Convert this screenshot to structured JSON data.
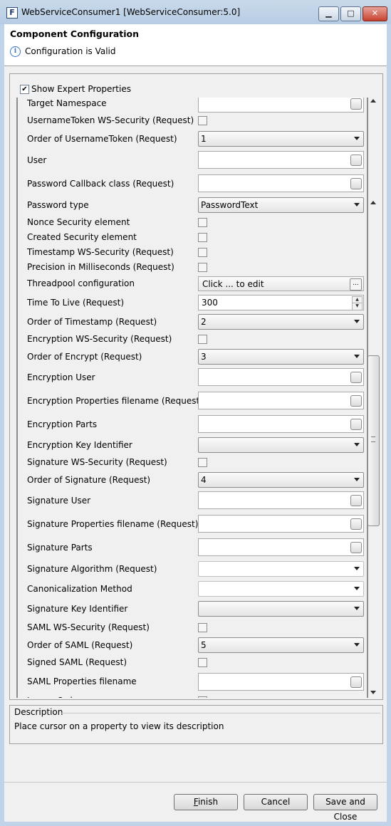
{
  "window": {
    "icon_letter": "F",
    "title": "WebServiceConsumer1 [WebServiceConsumer:5.0]",
    "min_icon": "minimize-icon",
    "max_icon": "maximize-icon",
    "close_icon": "close-icon",
    "min_glyph": "▁",
    "max_glyph": "□",
    "close_glyph": "✕"
  },
  "header": {
    "title": "Component Configuration",
    "info_glyph": "i",
    "message": "Configuration is Valid"
  },
  "expert": {
    "label": "Show Expert Properties",
    "checked": true,
    "check_glyph": "✔"
  },
  "properties": [
    {
      "label": "Target Namespace",
      "type": "text",
      "value": ""
    },
    {
      "label": "UsernameToken WS-Security (Request)",
      "type": "check",
      "value": ""
    },
    {
      "label": "Order of UsernameToken (Request)",
      "type": "select",
      "value": "1"
    },
    {
      "label": "User",
      "type": "text",
      "value": ""
    },
    {
      "label": "Password Callback class (Request)",
      "type": "text",
      "value": ""
    },
    {
      "label": "Password type",
      "type": "select",
      "value": "PasswordText"
    },
    {
      "label": "Nonce Security element",
      "type": "check",
      "value": ""
    },
    {
      "label": "Created Security element",
      "type": "check",
      "value": ""
    },
    {
      "label": "Timestamp WS-Security (Request)",
      "type": "check",
      "value": ""
    },
    {
      "label": "Precision in Milliseconds (Request)",
      "type": "check",
      "value": ""
    },
    {
      "label": "Threadpool configuration",
      "type": "button",
      "value": "Click ... to edit"
    },
    {
      "label": "Time To Live (Request)",
      "type": "spin",
      "value": "300"
    },
    {
      "label": "Order of Timestamp (Request)",
      "type": "select",
      "value": "2"
    },
    {
      "label": "Encryption WS-Security (Request)",
      "type": "check",
      "value": ""
    },
    {
      "label": "Order of Encrypt (Request)",
      "type": "select",
      "value": "3"
    },
    {
      "label": "Encryption User",
      "type": "text",
      "value": ""
    },
    {
      "label": "Encryption Properties filename (Request)",
      "type": "text",
      "value": ""
    },
    {
      "label": "Encryption Parts",
      "type": "text",
      "value": ""
    },
    {
      "label": "Encryption Key Identifier",
      "type": "select",
      "value": ""
    },
    {
      "label": "Signature WS-Security (Request)",
      "type": "check",
      "value": ""
    },
    {
      "label": "Order of Signature (Request)",
      "type": "select",
      "value": "4"
    },
    {
      "label": "Signature User",
      "type": "text",
      "value": ""
    },
    {
      "label": "Signature Properties filename (Request)",
      "type": "text",
      "value": ""
    },
    {
      "label": "Signature Parts",
      "type": "text",
      "value": ""
    },
    {
      "label": "Signature Algorithm (Request)",
      "type": "select-white",
      "value": ""
    },
    {
      "label": "Canonicalization Method",
      "type": "select-white",
      "value": ""
    },
    {
      "label": "Signature Key Identifier",
      "type": "select",
      "value": ""
    },
    {
      "label": "SAML WS-Security (Request)",
      "type": "check",
      "value": ""
    },
    {
      "label": "Order of SAML (Request)",
      "type": "select",
      "value": "5"
    },
    {
      "label": "Signed SAML (Request)",
      "type": "check",
      "value": ""
    },
    {
      "label": "SAML Properties filename",
      "type": "text",
      "value": ""
    },
    {
      "label": "Ignore Order",
      "type": "check",
      "value": ""
    }
  ],
  "description": {
    "title": "Description",
    "text": "Place cursor on a property to view its description"
  },
  "footer": {
    "finish_first": "F",
    "finish_rest": "inish",
    "cancel": "Cancel",
    "save_close": "Save and Close"
  }
}
